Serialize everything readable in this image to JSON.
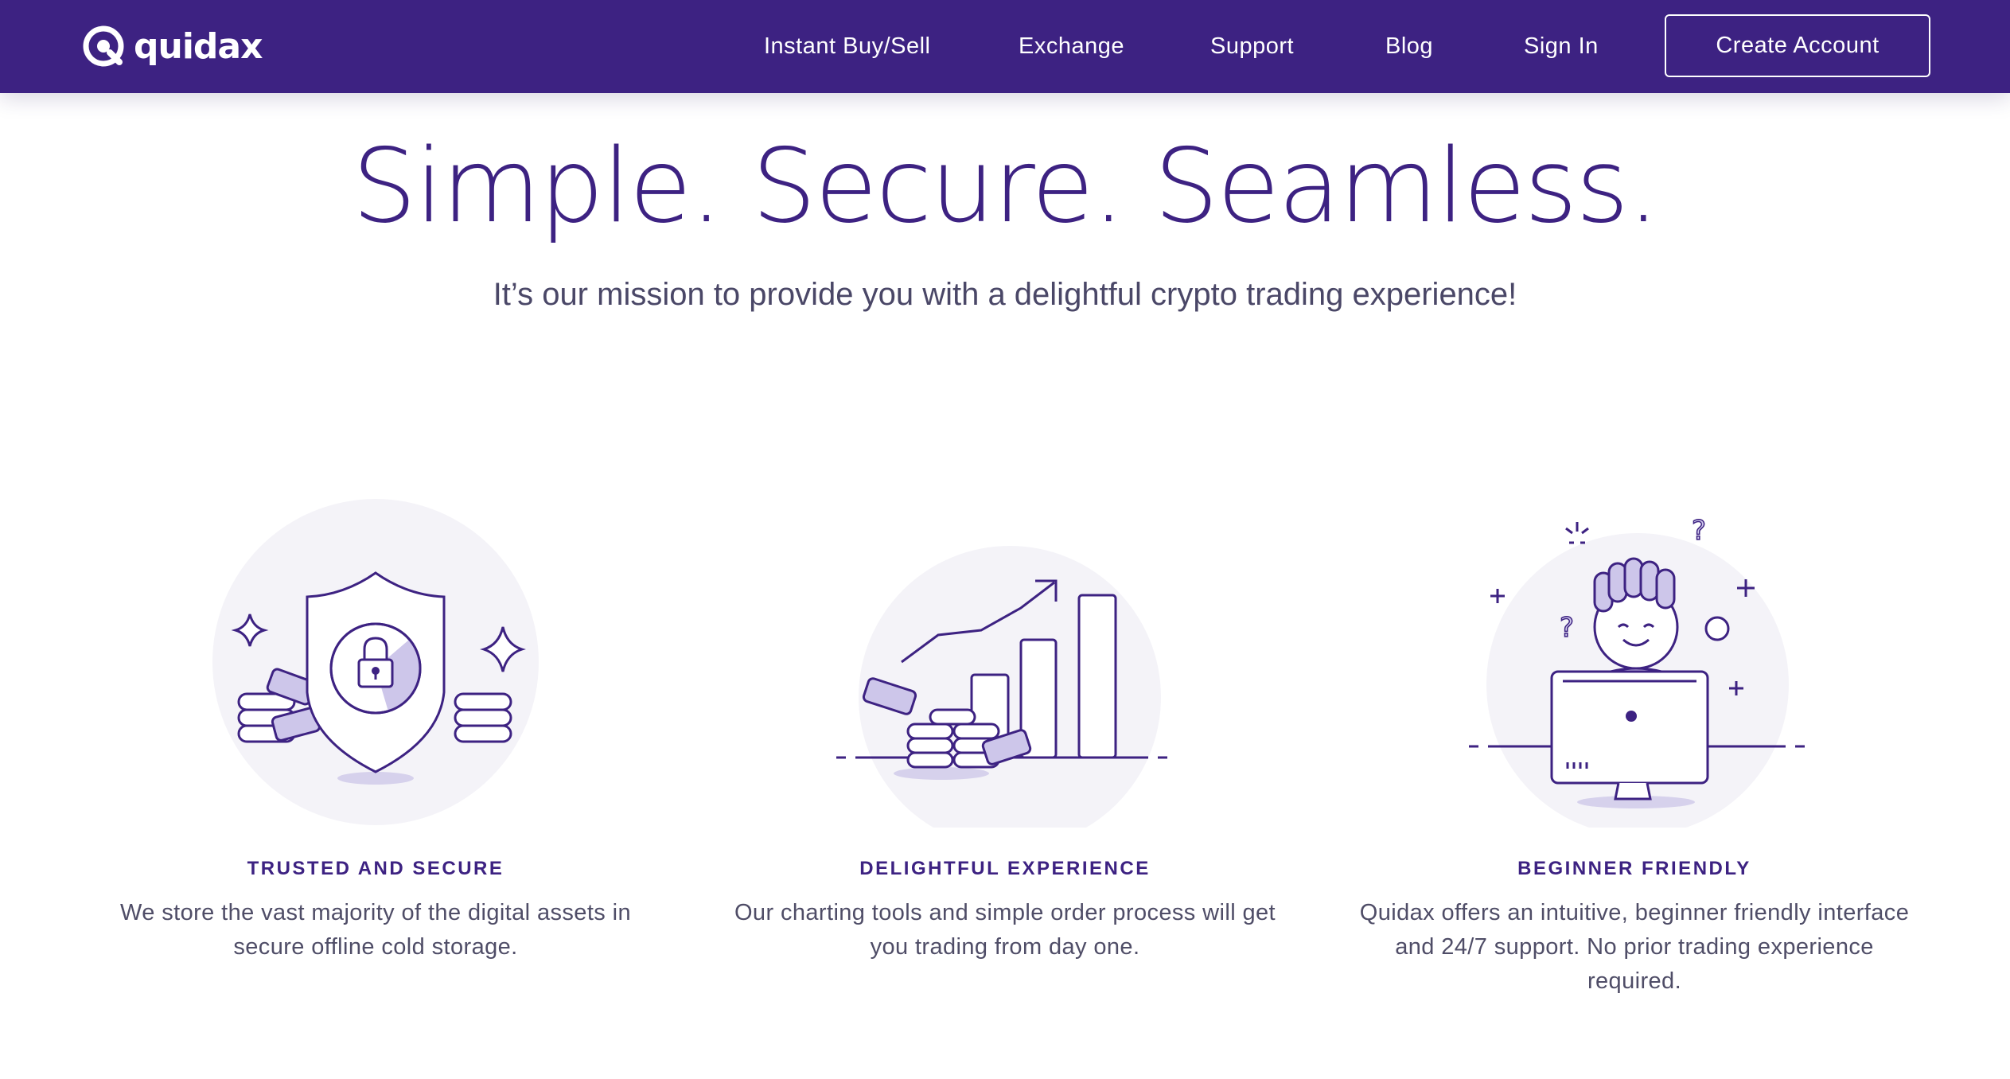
{
  "brand": {
    "name": "quidax",
    "logo_icon": "quidax-q-logo-icon",
    "primary_color": "#3d2282",
    "accent_color": "#cdc6ea"
  },
  "nav": {
    "links": [
      {
        "label": "Instant Buy/Sell"
      },
      {
        "label": "Exchange"
      },
      {
        "label": "Support"
      },
      {
        "label": "Blog"
      },
      {
        "label": "Sign In"
      }
    ],
    "cta_label": "Create Account"
  },
  "hero": {
    "title": "Simple. Secure. Seamless.",
    "subtitle": "It’s our mission to provide you with a delightful crypto trading experience!"
  },
  "features": [
    {
      "icon": "shield-lock-illustration",
      "title": "TRUSTED AND SECURE",
      "description": "We store the vast majority of the digital assets in secure offline cold storage."
    },
    {
      "icon": "growth-chart-illustration",
      "title": "DELIGHTFUL EXPERIENCE",
      "description": "Our charting tools and simple order process will get you trading from day one."
    },
    {
      "icon": "person-computer-illustration",
      "title": "BEGINNER FRIENDLY",
      "description": "Quidax offers an intuitive, beginner friendly interface and 24/7 support. No prior trading experience required."
    }
  ]
}
